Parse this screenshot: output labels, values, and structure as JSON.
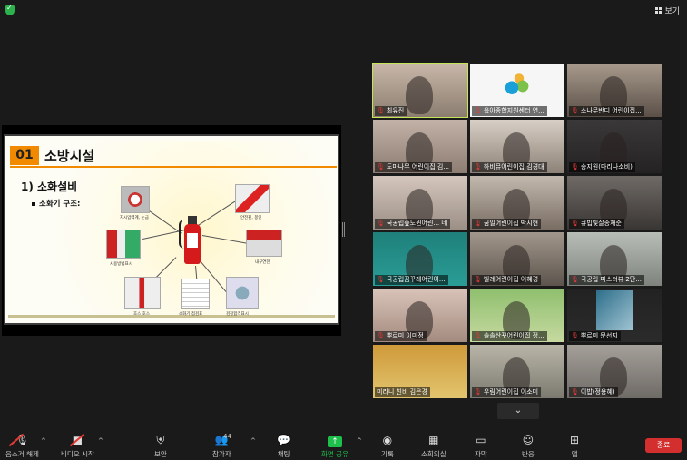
{
  "topbar": {
    "view_label": "보기"
  },
  "slide": {
    "number": "01",
    "title": "소방시설",
    "subtitle": "1) 소화설비",
    "bullet": "소화기 구조:",
    "parts": [
      {
        "label": "지시압력계, 눈금"
      },
      {
        "label": "안전핀, 봉인"
      },
      {
        "label": "용기",
        "sub": ""
      },
      {
        "label": "사용방법표시"
      },
      {
        "label": "내구연한"
      },
      {
        "label": "호스 호스"
      },
      {
        "label": "소화기 점검표"
      },
      {
        "label": "검정합격표시"
      }
    ]
  },
  "participants": [
    {
      "name": "최유진",
      "mic_muted": true,
      "active": true
    },
    {
      "name": "육아종합지원센터 연...",
      "mic_muted": true
    },
    {
      "name": "소나무반디 어린이집...",
      "mic_muted": true
    },
    {
      "name": "도마나무 어린이집 김...",
      "mic_muted": true
    },
    {
      "name": "하비뮤어린이집 김경대",
      "mic_muted": true
    },
    {
      "name": "송지원(마리나소비)",
      "mic_muted": true
    },
    {
      "name": "국공립숲도윈어린... 네",
      "mic_muted": true
    },
    {
      "name": "꿈일어린이집 박시현",
      "mic_muted": true
    },
    {
      "name": "큐빕빛살송재순",
      "mic_muted": true
    },
    {
      "name": "국공립꿈꾸래어린이...",
      "mic_muted": true
    },
    {
      "name": "빌레어린이집 이혜경",
      "mic_muted": true
    },
    {
      "name": "국공립 마스터뷰 2단...",
      "mic_muted": true
    },
    {
      "name": "뿌르미 이미정",
      "mic_muted": true
    },
    {
      "name": "솔솔산꾸어린이집 정...",
      "mic_muted": true
    },
    {
      "name": "뿌르미 문선지",
      "mic_muted": true
    },
    {
      "name": "미라니 친비 김은경",
      "mic_muted": false
    },
    {
      "name": "우림어린이집 이소미",
      "mic_muted": true
    },
    {
      "name": "이밥(정용혜)",
      "mic_muted": true
    }
  ],
  "toolbar": {
    "mute_label": "음소거 해제",
    "video_label": "비디오 시작",
    "security_label": "보안",
    "participants_label": "참가자",
    "participants_count": "44",
    "chat_label": "채팅",
    "share_label": "화면 공유",
    "record_label": "기록",
    "rooms_label": "소회의실",
    "caption_label": "자막",
    "reactions_label": "반응",
    "apps_label": "앱",
    "end_label": "종료"
  },
  "colors": {
    "accent_orange": "#f28a00",
    "active_border": "#c4e55a",
    "end_red": "#d32f2f",
    "share_green": "#1fbf4c"
  }
}
